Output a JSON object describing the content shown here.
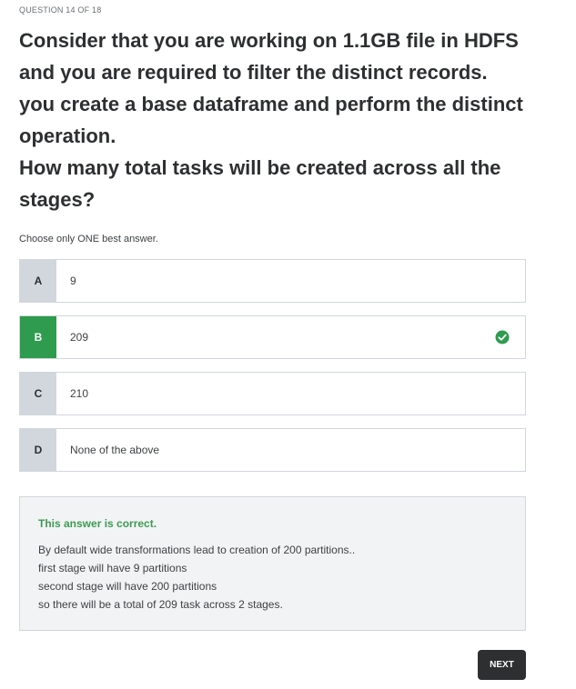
{
  "question_counter": "QUESTION 14 OF 18",
  "question_lines": [
    "Consider that you are working on 1.1GB file in HDFS",
    "and you are required to filter the distinct records.",
    "you create a base dataframe and perform the distinct",
    "operation.",
    "How many total tasks will be created across all the",
    "stages?"
  ],
  "instruction": "Choose only ONE best answer.",
  "options": [
    {
      "letter": "A",
      "text": "9"
    },
    {
      "letter": "B",
      "text": "209"
    },
    {
      "letter": "C",
      "text": "210"
    },
    {
      "letter": "D",
      "text": "None of the above"
    }
  ],
  "selected_option": "B",
  "selected_is_correct": true,
  "feedback": {
    "title": "This answer is correct.",
    "lines": [
      "By default wide transformations lead to creation of 200 partitions..",
      "first stage will have 9 partitions",
      "second stage will have 200 partitions",
      "so there will be a total of 209 task across 2 stages."
    ]
  },
  "next_label": "NEXT",
  "colors": {
    "correct": "#2e9b4e",
    "text": "#2d2f31",
    "border": "#d1d7dc",
    "button": "#2d2f31"
  },
  "icons": {
    "correct_marker": "check-circle-icon"
  }
}
